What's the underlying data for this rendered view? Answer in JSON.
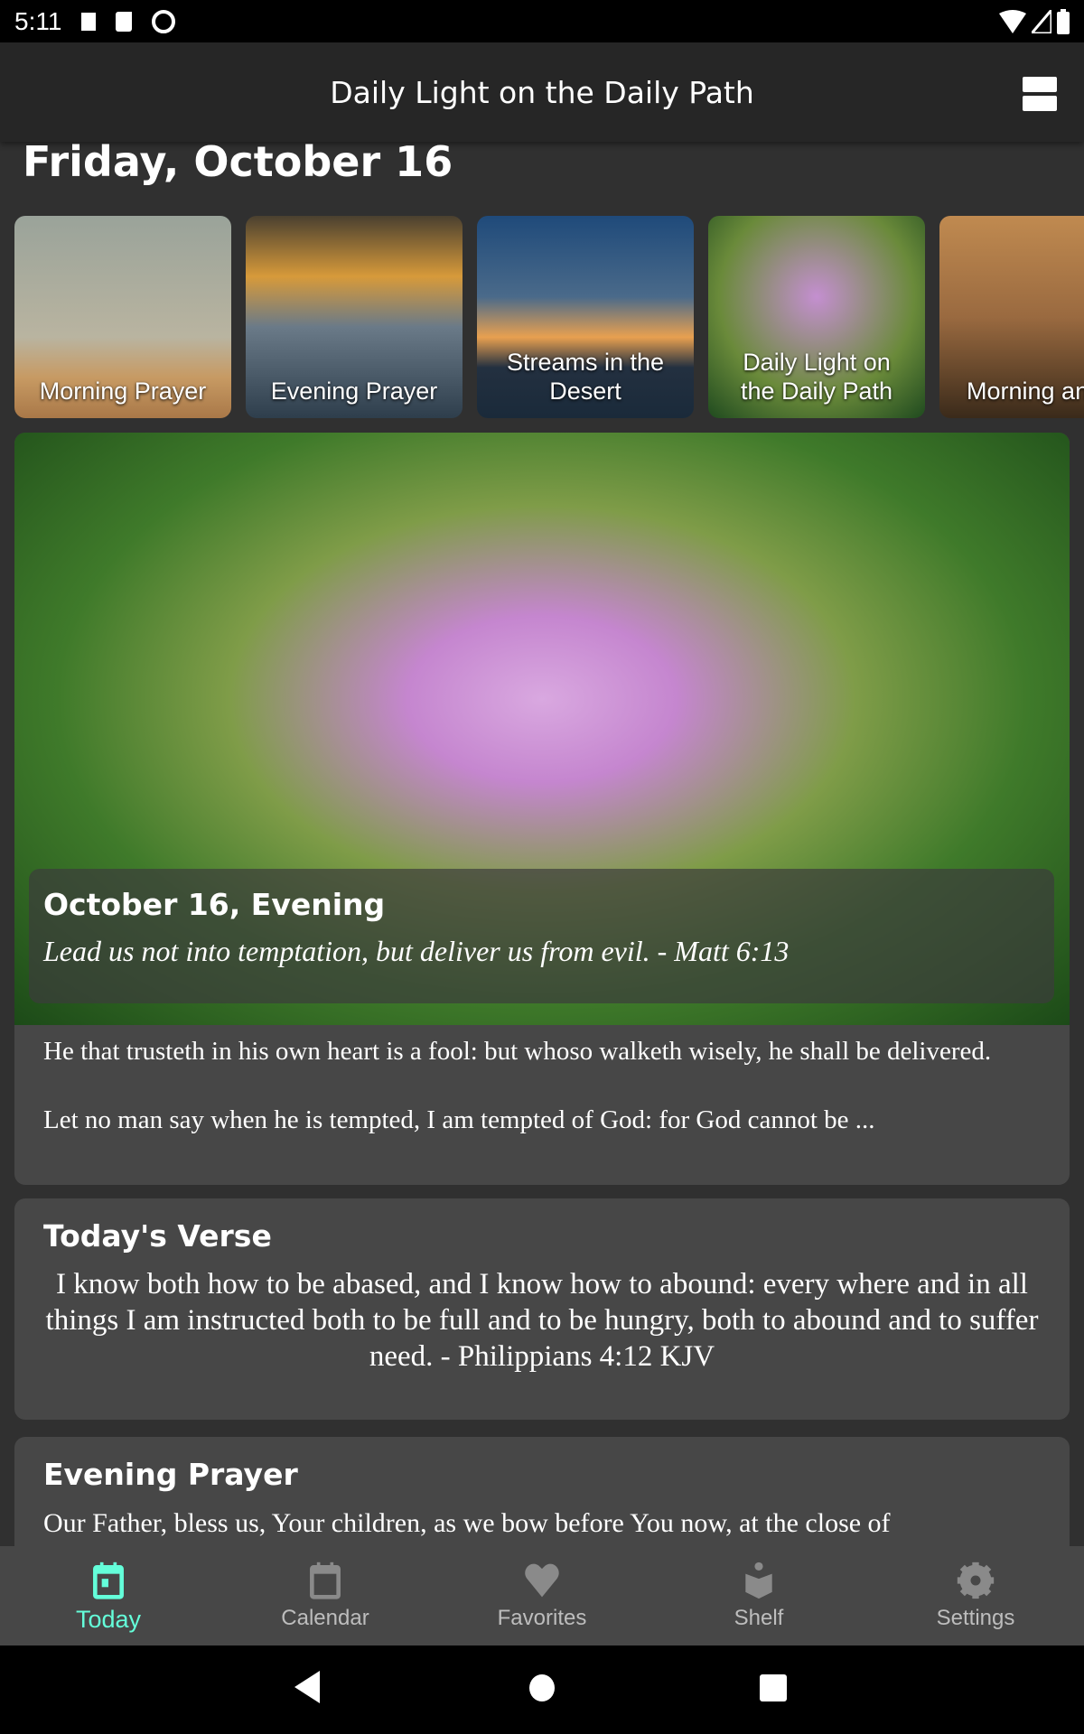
{
  "status_bar": {
    "time": "5:11"
  },
  "app_bar": {
    "title": "Daily Light on the Daily Path"
  },
  "date_heading": "Friday, October 16",
  "carousel": [
    {
      "label": "Morning Prayer"
    },
    {
      "label": "Evening Prayer"
    },
    {
      "label": "Streams in the Desert"
    },
    {
      "label": "Daily Light on the Daily Path"
    },
    {
      "label": "Morning and Evening"
    }
  ],
  "featured": {
    "title": "October 16, Evening",
    "verse": "Lead us not into temptation, but deliver us from evil. - Matt 6:13",
    "para1": "He that trusteth in his own heart is a fool: but whoso walketh wisely, he shall be delivered.",
    "para2": "Let no man say when he is tempted, I am tempted of God: for God cannot be ..."
  },
  "todays_verse": {
    "title": "Today's Verse",
    "text": "I know both how to be abased, and I know how to abound: every where and in all things I am instructed both to be full and to be hungry, both to abound and to suffer need. - Philippians 4:12 KJV"
  },
  "evening_prayer": {
    "title": "Evening Prayer",
    "text": "Our Father, bless us, Your children, as we bow before You now, at the close of"
  },
  "bottom_nav": [
    {
      "label": "Today",
      "icon": "calendar-today-icon",
      "active": true
    },
    {
      "label": "Calendar",
      "icon": "calendar-icon"
    },
    {
      "label": "Favorites",
      "icon": "heart-icon"
    },
    {
      "label": "Shelf",
      "icon": "reader-icon"
    },
    {
      "label": "Settings",
      "icon": "gear-icon"
    }
  ],
  "colors": {
    "accent": "#64ffda",
    "background": "#303030",
    "card": "#474747",
    "app_bar": "#262626"
  }
}
